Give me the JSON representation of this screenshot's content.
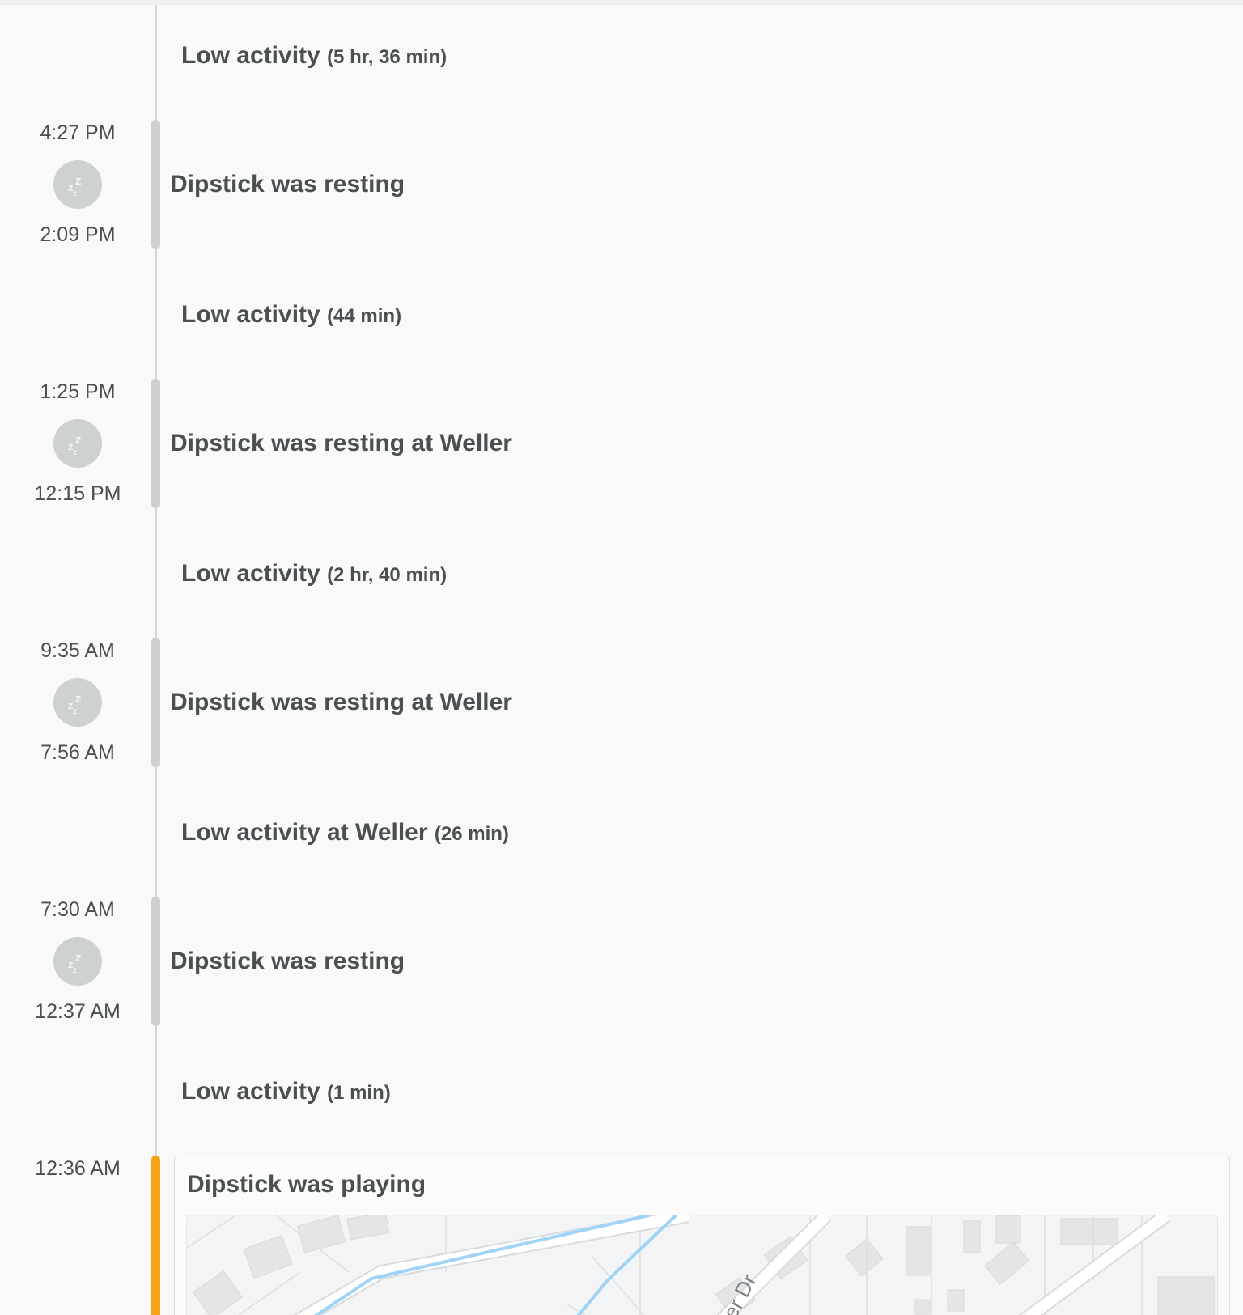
{
  "pet_name": "Dipstick",
  "timeline": {
    "gaps": [
      {
        "label": "Low activity",
        "duration": "(5 hr, 36 min)"
      },
      {
        "label": "Low activity",
        "duration": "(44 min)"
      },
      {
        "label": "Low activity",
        "duration": "(2 hr, 40 min)"
      },
      {
        "label": "Low activity at Weller",
        "duration": "(26 min)"
      },
      {
        "label": "Low activity",
        "duration": "(1 min)"
      }
    ],
    "events": [
      {
        "type": "resting",
        "icon": "sleep-zzz-icon",
        "end_time": "4:27 PM",
        "start_time": "2:09 PM",
        "title": "Dipstick was resting"
      },
      {
        "type": "resting",
        "icon": "sleep-zzz-icon",
        "end_time": "1:25 PM",
        "start_time": "12:15 PM",
        "title": "Dipstick was resting at Weller"
      },
      {
        "type": "resting",
        "icon": "sleep-zzz-icon",
        "end_time": "9:35 AM",
        "start_time": "7:56 AM",
        "title": "Dipstick was resting at Weller"
      },
      {
        "type": "resting",
        "icon": "sleep-zzz-icon",
        "end_time": "7:30 AM",
        "start_time": "12:37 AM",
        "title": "Dipstick was resting"
      }
    ],
    "playing_event": {
      "type": "playing",
      "end_time": "12:36 AM",
      "title": "Dipstick was playing",
      "map": {
        "street_label": "ller Dr"
      }
    }
  },
  "colors": {
    "background": "#f9f9f9",
    "text": "#4a4f52",
    "timeline_line": "#d4d6d7",
    "rest_bar": "#ccd0d1",
    "play_bar": "#f8a314",
    "map_route": "#9fd3f7"
  }
}
